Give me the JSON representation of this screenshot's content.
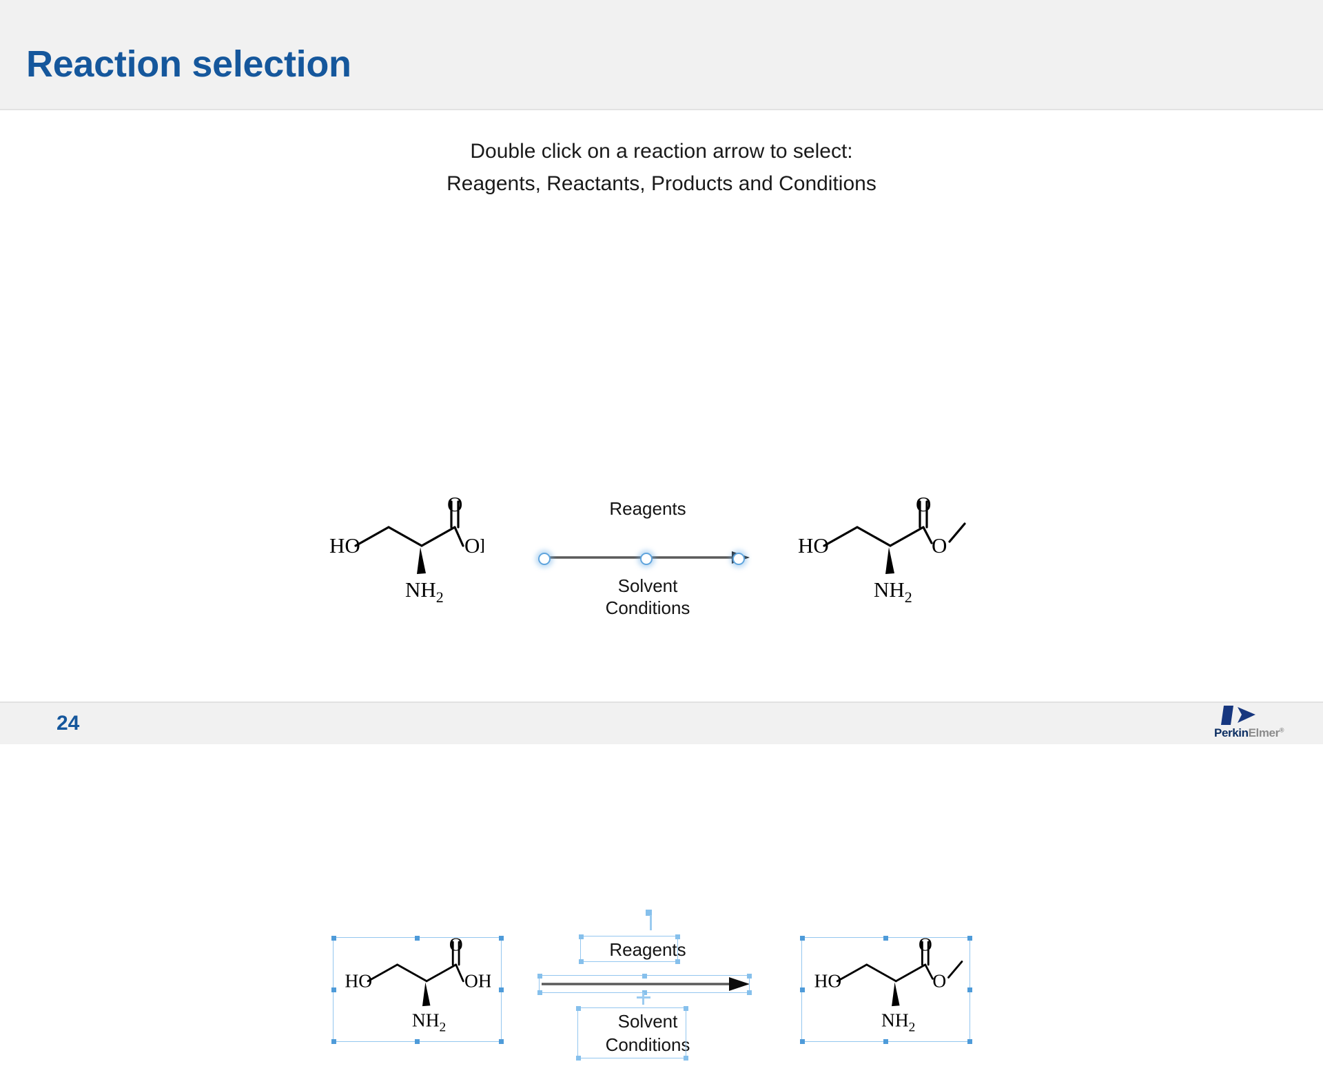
{
  "header": {
    "title": "Reaction selection",
    "title_color": "#15579c",
    "background": "#f1f1f1"
  },
  "subtitle": {
    "line1": "Double click on a reaction arrow to select:",
    "line2": "Reagents, Reactants, Products and Conditions"
  },
  "schemes": [
    {
      "id": "unselected-scheme",
      "reactant": {
        "name": "serine",
        "labels": [
          "HO",
          "O",
          "OH",
          "NH",
          "2"
        ]
      },
      "arrow": {
        "above": "Reagents",
        "below_line1": "Solvent",
        "below_line2": "Conditions",
        "selected": true,
        "selection_style": "circular-handles",
        "handle_color": "#5fa4dd"
      },
      "product": {
        "name": "serine methyl ester",
        "labels": [
          "HO",
          "O",
          "O",
          "NH",
          "2"
        ]
      }
    },
    {
      "id": "selected-scheme",
      "reactant": {
        "name": "serine",
        "labels": [
          "HO",
          "O",
          "OH",
          "NH",
          "2"
        ],
        "selected": true
      },
      "arrow": {
        "above": "Reagents",
        "below_line1": "Solvent",
        "below_line2": "Conditions",
        "selected": true,
        "selection_style": "bounding-boxes",
        "handle_color": "#4e9bd9",
        "box_color": "#93c6ef"
      },
      "product": {
        "name": "serine methyl ester",
        "labels": [
          "HO",
          "O",
          "O",
          "NH",
          "2"
        ],
        "selected": true
      }
    }
  ],
  "footer": {
    "page_number": "24",
    "logo": {
      "brand_first": "Perkin",
      "brand_second": "Elmer",
      "trademark": "®",
      "mark_color": "#17377f"
    }
  }
}
